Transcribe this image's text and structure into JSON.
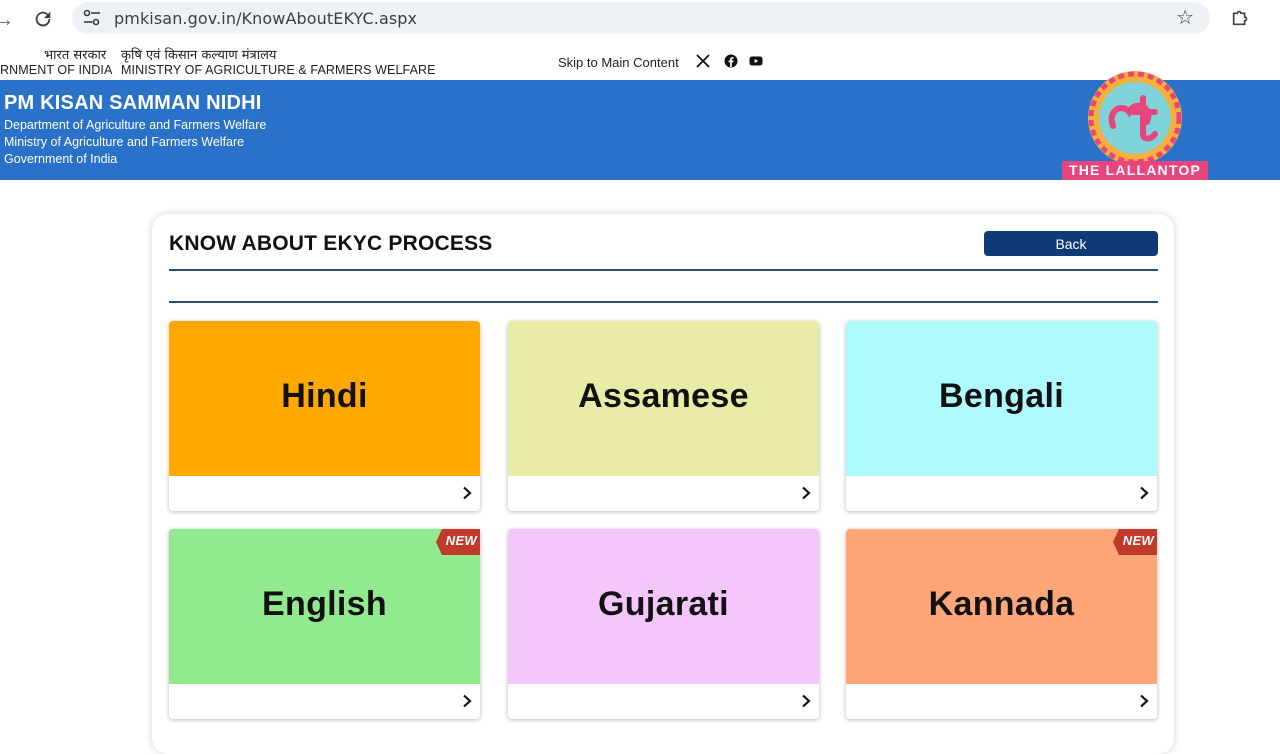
{
  "browser": {
    "url": "pmkisan.gov.in/KnowAboutEKYC.aspx"
  },
  "gov_strip": {
    "hindi_gov": "भारत सरकार",
    "english_gov": "RNMENT OF INDIA",
    "hindi_ministry": "कृषि एवं किसान कल्याण मंत्रालय",
    "english_ministry": "MINISTRY OF AGRICULTURE & FARMERS WELFARE",
    "skip_link": "Skip to Main Content"
  },
  "header": {
    "title": "PM KISAN SAMMAN NIDHI",
    "sub1": "Department of Agriculture and Farmers Welfare",
    "sub2": "Ministry of Agriculture and Farmers Welfare",
    "sub3": "Government of India",
    "logo_text": "THE LALLANTOP"
  },
  "main": {
    "title": "KNOW ABOUT EKYC PROCESS",
    "back_label": "Back",
    "languages": [
      {
        "name": "Hindi",
        "color": "#ffa800",
        "is_new": false
      },
      {
        "name": "Assamese",
        "color": "#e8eca6",
        "is_new": false
      },
      {
        "name": "Bengali",
        "color": "#aefbff",
        "is_new": false
      },
      {
        "name": "English",
        "color": "#92ea8f",
        "is_new": true,
        "badge": "NEW"
      },
      {
        "name": "Gujarati",
        "color": "#f5c6fb",
        "is_new": false
      },
      {
        "name": "Kannada",
        "color": "#ffa679",
        "is_new": true,
        "badge": "NEW"
      }
    ]
  },
  "colors": {
    "header_blue": "#2a72c9",
    "back_button": "#0e3b78",
    "badge_red": "#c0392b"
  }
}
